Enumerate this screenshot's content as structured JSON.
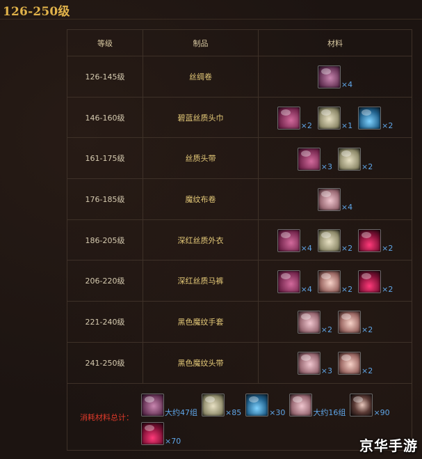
{
  "title": "126-250级",
  "table": {
    "headers": [
      "等级",
      "制品",
      "材料"
    ],
    "rows": [
      {
        "level": "126-145级",
        "product": "丝绸卷",
        "materials": [
          {
            "icon": "silk-roll-icon",
            "theme": "silk-roll",
            "qty": "×4"
          }
        ]
      },
      {
        "level": "146-160级",
        "product": "碧蓝丝质头巾",
        "materials": [
          {
            "icon": "silk-cloth-icon",
            "theme": "silk-pink",
            "qty": "×2"
          },
          {
            "icon": "thread-spool-icon",
            "theme": "thread",
            "qty": "×1"
          },
          {
            "icon": "blue-dye-vial-icon",
            "theme": "blue-vial",
            "qty": "×2"
          }
        ]
      },
      {
        "level": "161-175级",
        "product": "丝质头带",
        "materials": [
          {
            "icon": "silk-cloth-icon",
            "theme": "silk-pink",
            "qty": "×3"
          },
          {
            "icon": "thread-spool-icon",
            "theme": "thread",
            "qty": "×2"
          }
        ]
      },
      {
        "level": "176-185级",
        "product": "魔纹布卷",
        "materials": [
          {
            "icon": "mageweave-cloth-icon",
            "theme": "mag-cloth",
            "qty": "×4"
          }
        ]
      },
      {
        "level": "186-205级",
        "product": "深红丝质外衣",
        "materials": [
          {
            "icon": "silk-cloth-icon",
            "theme": "silk-pink",
            "qty": "×4"
          },
          {
            "icon": "thread-spool-icon",
            "theme": "thread",
            "qty": "×2"
          },
          {
            "icon": "red-dye-vial-icon",
            "theme": "red-vial",
            "qty": "×2"
          }
        ]
      },
      {
        "level": "206-220级",
        "product": "深红丝质马裤",
        "materials": [
          {
            "icon": "silk-cloth-icon",
            "theme": "silk-pink",
            "qty": "×4"
          },
          {
            "icon": "cloth-bolt-icon",
            "theme": "bolt",
            "qty": "×2"
          },
          {
            "icon": "red-dye-vial-icon",
            "theme": "red-vial",
            "qty": "×2"
          }
        ]
      },
      {
        "level": "221-240级",
        "product": "黑色魔纹手套",
        "materials": [
          {
            "icon": "mageweave-bolt-icon",
            "theme": "mag-cloth",
            "qty": "×2"
          },
          {
            "icon": "cloth-bolt-icon",
            "theme": "bolt",
            "qty": "×2"
          }
        ]
      },
      {
        "level": "241-250级",
        "product": "黑色魔纹头带",
        "materials": [
          {
            "icon": "mageweave-bolt-icon",
            "theme": "mag-cloth",
            "qty": "×3"
          },
          {
            "icon": "cloth-bolt-icon",
            "theme": "bolt",
            "qty": "×2"
          }
        ]
      }
    ]
  },
  "summary": {
    "label": "消耗材料总计：",
    "items": [
      {
        "icon": "silk-roll-icon",
        "theme": "silk-roll",
        "qty": "大约47组"
      },
      {
        "icon": "thread-spool-icon",
        "theme": "thread",
        "qty": "×85"
      },
      {
        "icon": "blue-dye-vial-icon",
        "theme": "blue-vial",
        "qty": "×30"
      },
      {
        "icon": "mageweave-cloth-icon",
        "theme": "mag-cloth",
        "qty": "大约16组"
      },
      {
        "icon": "dark-bolt-icon",
        "theme": "dark-bolt",
        "qty": "×90"
      },
      {
        "icon": "red-dye-vial-icon",
        "theme": "red-vial",
        "qty": "×70"
      }
    ]
  },
  "watermark": "京华手游",
  "colors": {
    "title": "#e0b24a",
    "qty": "#5fa6e8",
    "summary_label": "#e03a2a",
    "product": "#e4c978"
  }
}
